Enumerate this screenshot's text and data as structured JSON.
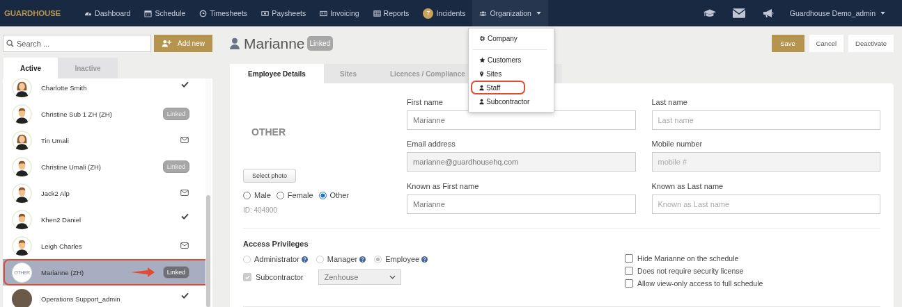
{
  "nav": {
    "logo": "GUARDHOUSE",
    "items": [
      {
        "label": "Dashboard",
        "expanded": false
      },
      {
        "label": "Schedule",
        "expanded": false
      },
      {
        "label": "Timesheets",
        "expanded": false
      },
      {
        "label": "Paysheets",
        "expanded": false
      },
      {
        "label": "Invoicing",
        "expanded": false
      },
      {
        "label": "Reports",
        "expanded": false
      },
      {
        "label": "Incidents",
        "badge": "7",
        "expanded": false
      },
      {
        "label": "Organization",
        "expanded": true
      }
    ],
    "user": "Guardhouse Demo_admin",
    "menu": [
      {
        "kind": "item",
        "label": "Company",
        "highlighted": false
      },
      {
        "kind": "divider"
      },
      {
        "kind": "item",
        "label": "Customers",
        "highlighted": false
      },
      {
        "kind": "item",
        "label": "Sites",
        "highlighted": false
      },
      {
        "kind": "item",
        "label": "Staff",
        "highlighted": true
      },
      {
        "kind": "item",
        "label": "Subcontractor",
        "highlighted": false
      }
    ]
  },
  "sidebar": {
    "search": {
      "placeholder": "Search ..."
    },
    "add_button": "Add new",
    "tabs": [
      {
        "label": "Active",
        "selected": true
      },
      {
        "label": "Inactive",
        "selected": false
      }
    ],
    "staff": [
      {
        "name": "Charlotte Smith",
        "avatar": {
          "kind": "female"
        },
        "status": {
          "kind": "check"
        },
        "selected": false,
        "highlighted": false
      },
      {
        "name": "Christine Sub 1 ZH (ZH)",
        "avatar": {
          "kind": "male"
        },
        "status": {
          "kind": "linked",
          "badge": "Linked"
        },
        "selected": false,
        "highlighted": false
      },
      {
        "name": "Tin Umali",
        "avatar": {
          "kind": "female"
        },
        "status": {
          "kind": "email"
        },
        "selected": false,
        "highlighted": false
      },
      {
        "name": "Christine Umali (ZH)",
        "avatar": {
          "kind": "male"
        },
        "status": {
          "kind": "linked",
          "badge": "Linked"
        },
        "selected": false,
        "highlighted": false
      },
      {
        "name": "Jack2 Alp",
        "avatar": {
          "kind": "male"
        },
        "status": {
          "kind": "email"
        },
        "selected": false,
        "highlighted": false
      },
      {
        "name": "Khen2 Daniel",
        "avatar": {
          "kind": "male"
        },
        "status": {
          "kind": "check"
        },
        "selected": false,
        "highlighted": false
      },
      {
        "name": "Leigh Charles",
        "avatar": {
          "kind": "male"
        },
        "status": {
          "kind": "email"
        },
        "selected": false,
        "highlighted": false
      },
      {
        "name": "Marianne (ZH)",
        "avatar": {
          "kind": "other",
          "text": "OTHER"
        },
        "status": {
          "kind": "linked",
          "badge": "Linked"
        },
        "selected": true,
        "highlighted": true
      },
      {
        "name": "Operations Support_admin",
        "avatar": {
          "kind": "photo"
        },
        "status": {
          "kind": "check"
        },
        "selected": false,
        "highlighted": false
      }
    ]
  },
  "employee": {
    "name": "Marianne",
    "badge": "Linked",
    "actions": [
      {
        "label": "Save",
        "kind": "primary"
      },
      {
        "label": "Cancel",
        "kind": "default"
      },
      {
        "label": "Deactivate",
        "kind": "default"
      }
    ],
    "tabs": [
      {
        "label": "Employee Details",
        "selected": true
      },
      {
        "label": "Sites",
        "selected": false
      },
      {
        "label": "Licences / Compliance",
        "selected": false
      }
    ],
    "photo_text": "OTHER",
    "select_photo": "Select photo",
    "gender": [
      {
        "label": "Male",
        "selected": false
      },
      {
        "label": "Female",
        "selected": false
      },
      {
        "label": "Other",
        "selected": true
      }
    ],
    "id_text": "ID: 404900",
    "fields": [
      {
        "label": "First name",
        "value": "Marianne",
        "disabled": false
      },
      {
        "label": "Last name",
        "placeholder": "Last name",
        "disabled": false
      },
      {
        "label": "Email address",
        "value": "marianne@guardhousehq.com",
        "disabled": true
      },
      {
        "label": "Mobile number",
        "placeholder": "mobile #",
        "disabled": true
      },
      {
        "label": "Known as First name",
        "value": "Marianne",
        "disabled": false
      },
      {
        "label": "Known as Last name",
        "placeholder": "Known as Last name",
        "disabled": false
      }
    ],
    "access": {
      "title": "Access Privileges",
      "roles": [
        {
          "label": "Administrator",
          "selected": false
        },
        {
          "label": "Manager",
          "selected": false
        },
        {
          "label": "Employee",
          "selected": true
        }
      ],
      "subcontractor": {
        "label": "Subcontractor",
        "checked": true,
        "value": "Zenhouse"
      },
      "options": [
        {
          "label": "Hide Marianne on the schedule",
          "checked": false
        },
        {
          "label": "Does not require security license",
          "checked": false
        },
        {
          "label": "Allow view-only access to full schedule",
          "checked": false
        }
      ]
    }
  }
}
